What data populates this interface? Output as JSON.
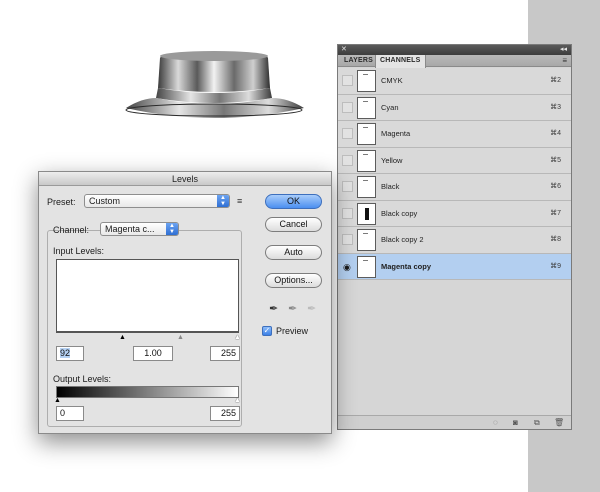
{
  "channels_panel": {
    "tabs": [
      {
        "label": "LAYERS",
        "active": false
      },
      {
        "label": "CHANNELS",
        "active": true
      }
    ],
    "channels": [
      {
        "name": "CMYK",
        "shortcut": "⌘2",
        "selected": false,
        "visible": false,
        "thumb": "white"
      },
      {
        "name": "Cyan",
        "shortcut": "⌘3",
        "selected": false,
        "visible": false,
        "thumb": "white"
      },
      {
        "name": "Magenta",
        "shortcut": "⌘4",
        "selected": false,
        "visible": false,
        "thumb": "white"
      },
      {
        "name": "Yellow",
        "shortcut": "⌘5",
        "selected": false,
        "visible": false,
        "thumb": "white"
      },
      {
        "name": "Black",
        "shortcut": "⌘6",
        "selected": false,
        "visible": false,
        "thumb": "white"
      },
      {
        "name": "Black copy",
        "shortcut": "⌘7",
        "selected": false,
        "visible": false,
        "thumb": "bar"
      },
      {
        "name": "Black copy 2",
        "shortcut": "⌘8",
        "selected": false,
        "visible": false,
        "thumb": "white"
      },
      {
        "name": "Magenta copy",
        "shortcut": "⌘9",
        "selected": true,
        "visible": true,
        "thumb": "white"
      }
    ],
    "selection_color": "#b3cff0"
  },
  "levels_dialog": {
    "title": "Levels",
    "preset_label": "Preset:",
    "preset_value": "Custom",
    "channel_label": "Channel:",
    "channel_value": "Magenta c...",
    "input_levels_label": "Input Levels:",
    "input_black": "92",
    "input_gamma": "1.00",
    "input_white": "255",
    "output_levels_label": "Output Levels:",
    "output_black": "0",
    "output_white": "255",
    "buttons": {
      "ok": "OK",
      "cancel": "Cancel",
      "auto": "Auto",
      "options": "Options..."
    },
    "preview_label": "Preview",
    "preview_checked": true,
    "accent_color": "#4b8ff0"
  }
}
